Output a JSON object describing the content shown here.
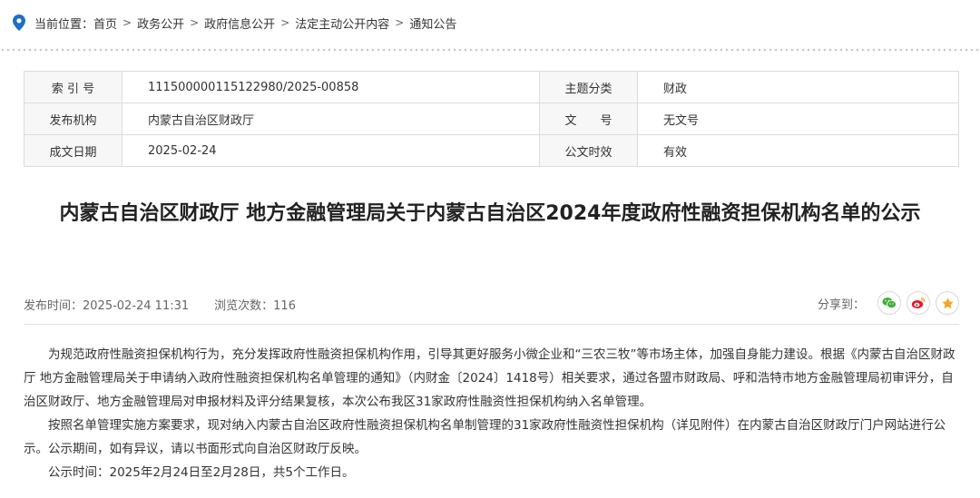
{
  "breadcrumb": {
    "label": "当前位置：",
    "items": [
      "首页",
      "政务公开",
      "政府信息公开",
      "法定主动公开内容",
      "通知公告"
    ],
    "separator": ">"
  },
  "meta": {
    "index_label": "索 引 号",
    "index_value": "11150000011512298 0/2025-00858",
    "topic_label": "主题分类",
    "topic_value": "财政",
    "publisher_label": "发布机构",
    "publisher_value": "内蒙古自治区财政厅",
    "docno_label": "文　　号",
    "docno_value": "无文号",
    "date_label": "成文日期",
    "date_value": "2025-02-24",
    "validity_label": "公文时效",
    "validity_value": "有效"
  },
  "article": {
    "title": "内蒙古自治区财政厅 地方金融管理局关于内蒙古自治区2024年度政府性融资担保机构名单的公示",
    "publish_time": "发布时间：2025-02-24 11:31",
    "views": "浏览次数：116",
    "share_label": "分享到：",
    "paragraphs": [
      "为规范政府性融资担保机构行为，充分发挥政府性融资担保机构作用，引导其更好服务小微企业和“三农三牧”等市场主体，加强自身能力建设。根据《内蒙古自治区财政厅 地方金融管理局关于申请纳入政府性融资担保机构名单管理的通知》（内财金〔2024〕1418号）相关要求，通过各盟市财政局、呼和浩特市地方金融管理局初审评分，自治区财政厅、地方金融管理局对申报材料及评分结果复核，本次公布我区31家政府性融资性担保机构纳入名单管理。",
      "按照名单管理实施方案要求，现对纳入内蒙古自治区政府性融资担保机构名单制管理的31家政府性融资性担保机构（详见附件）在内蒙古自治区财政厅门户网站进行公示。公示期间，如有异议，请以书面形式向自治区财政厅反映。",
      "公示时间：2025年2月24日至2月28日，共5个工作日。"
    ]
  },
  "icons": {
    "location": "location-pin-icon",
    "wechat": "wechat-icon",
    "weibo": "weibo-icon",
    "favorite": "star-icon"
  },
  "colors": {
    "accent": "#1f6fbf",
    "wechat": "#3cb034",
    "weibo": "#e6162d",
    "star": "#f5a623"
  }
}
